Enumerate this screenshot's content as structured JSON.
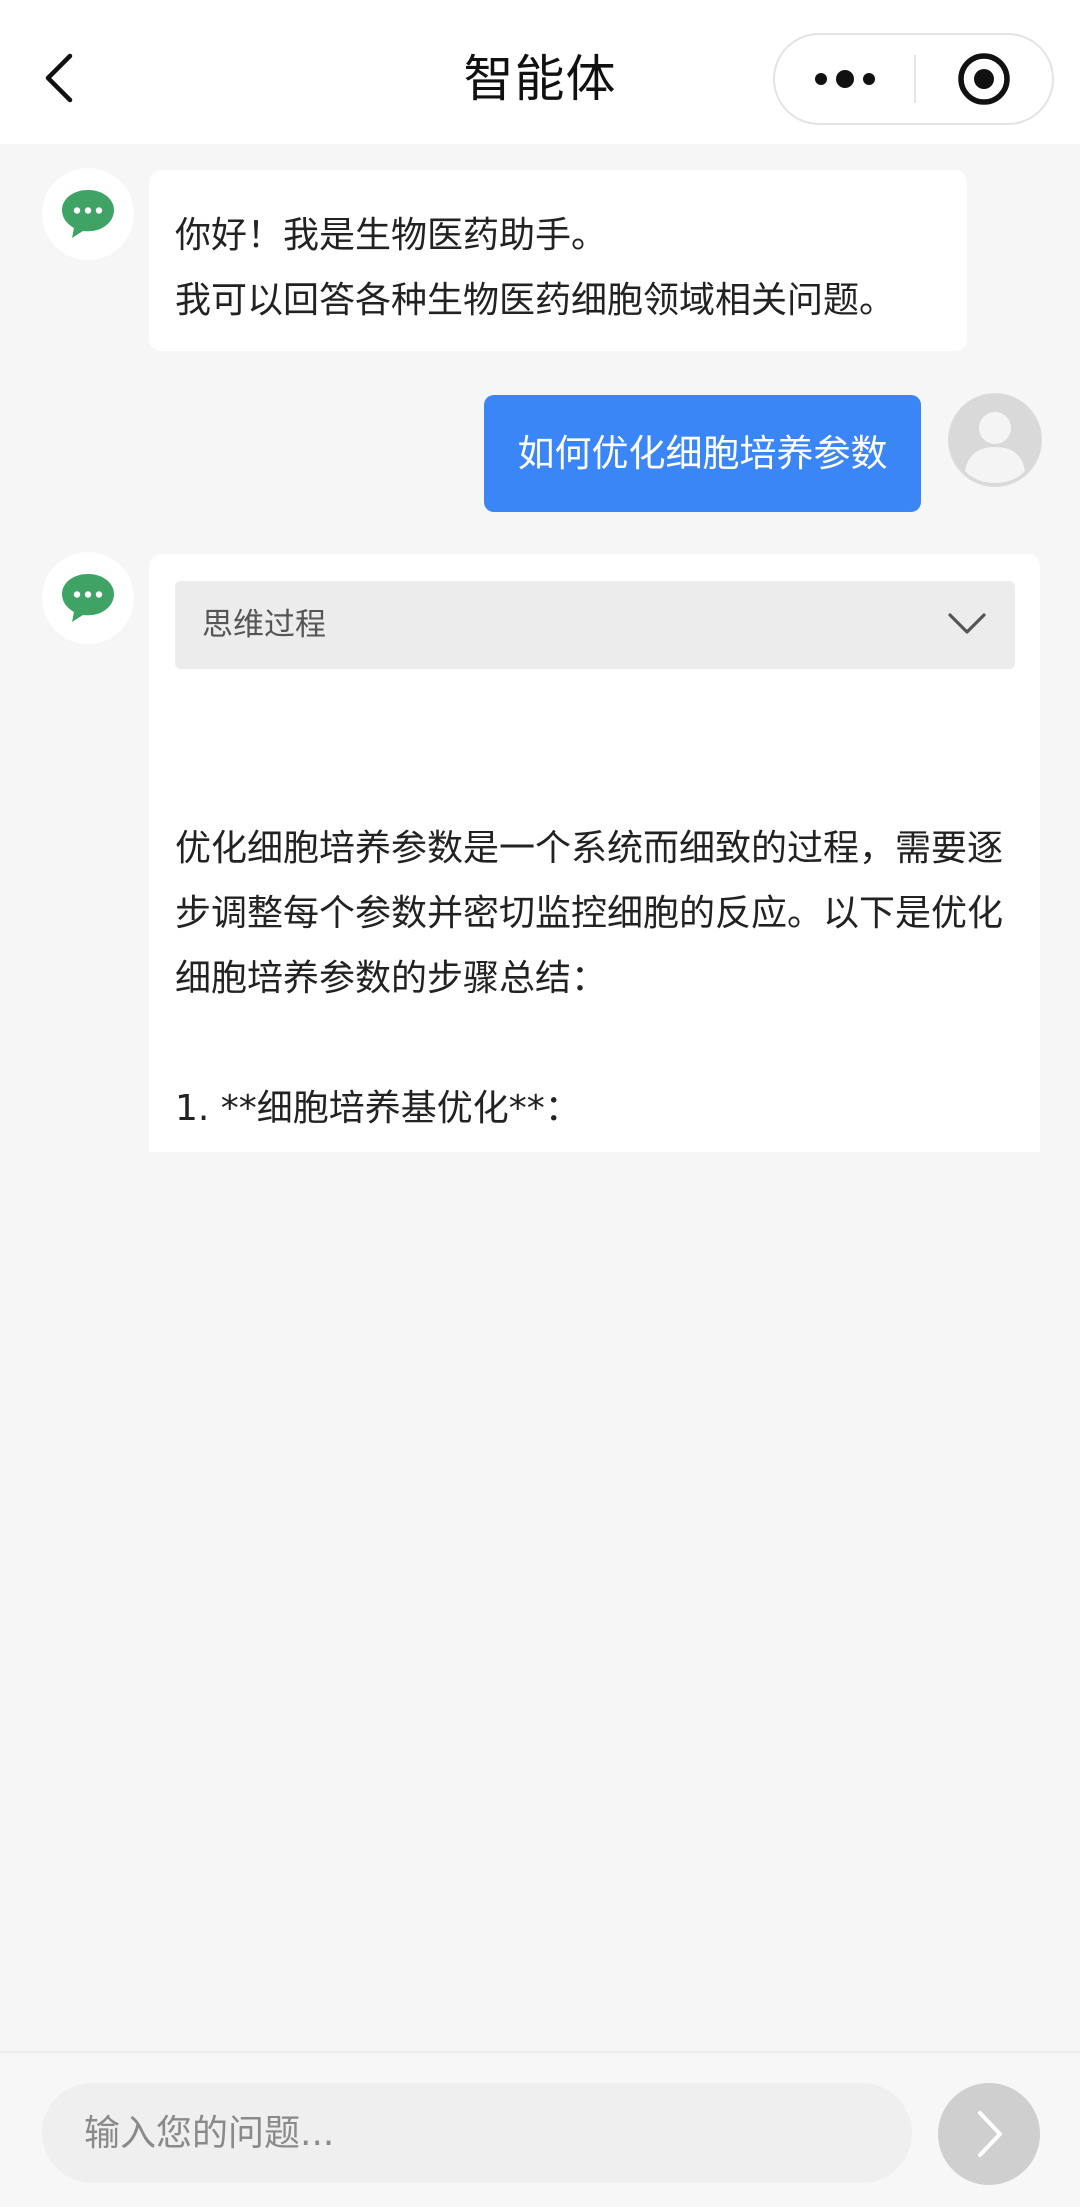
{
  "header": {
    "title": "智能体",
    "back_icon": "chevron-left-icon",
    "more_icon": "more-dots-icon",
    "close_icon": "target-circle-icon"
  },
  "messages": {
    "greeting": {
      "line1": "你好！我是生物医药助手。",
      "line2": "我可以回答各种生物医药细胞领域相关问题。"
    },
    "user_question": "如何优化细胞培养参数",
    "answer": {
      "thinking_label": "思维过程",
      "paragraph": "优化细胞培养参数是一个系统而细致的过程，需要逐步调整每个参数并密切监控细胞的反应。以下是优化细胞培养参数的步骤总结：",
      "item1": "1. **细胞培养基优化**："
    }
  },
  "input": {
    "placeholder": "输入您的问题..."
  },
  "colors": {
    "accent": "#3a86f6",
    "bot_icon": "#3ea364",
    "background": "#f6f6f6"
  }
}
